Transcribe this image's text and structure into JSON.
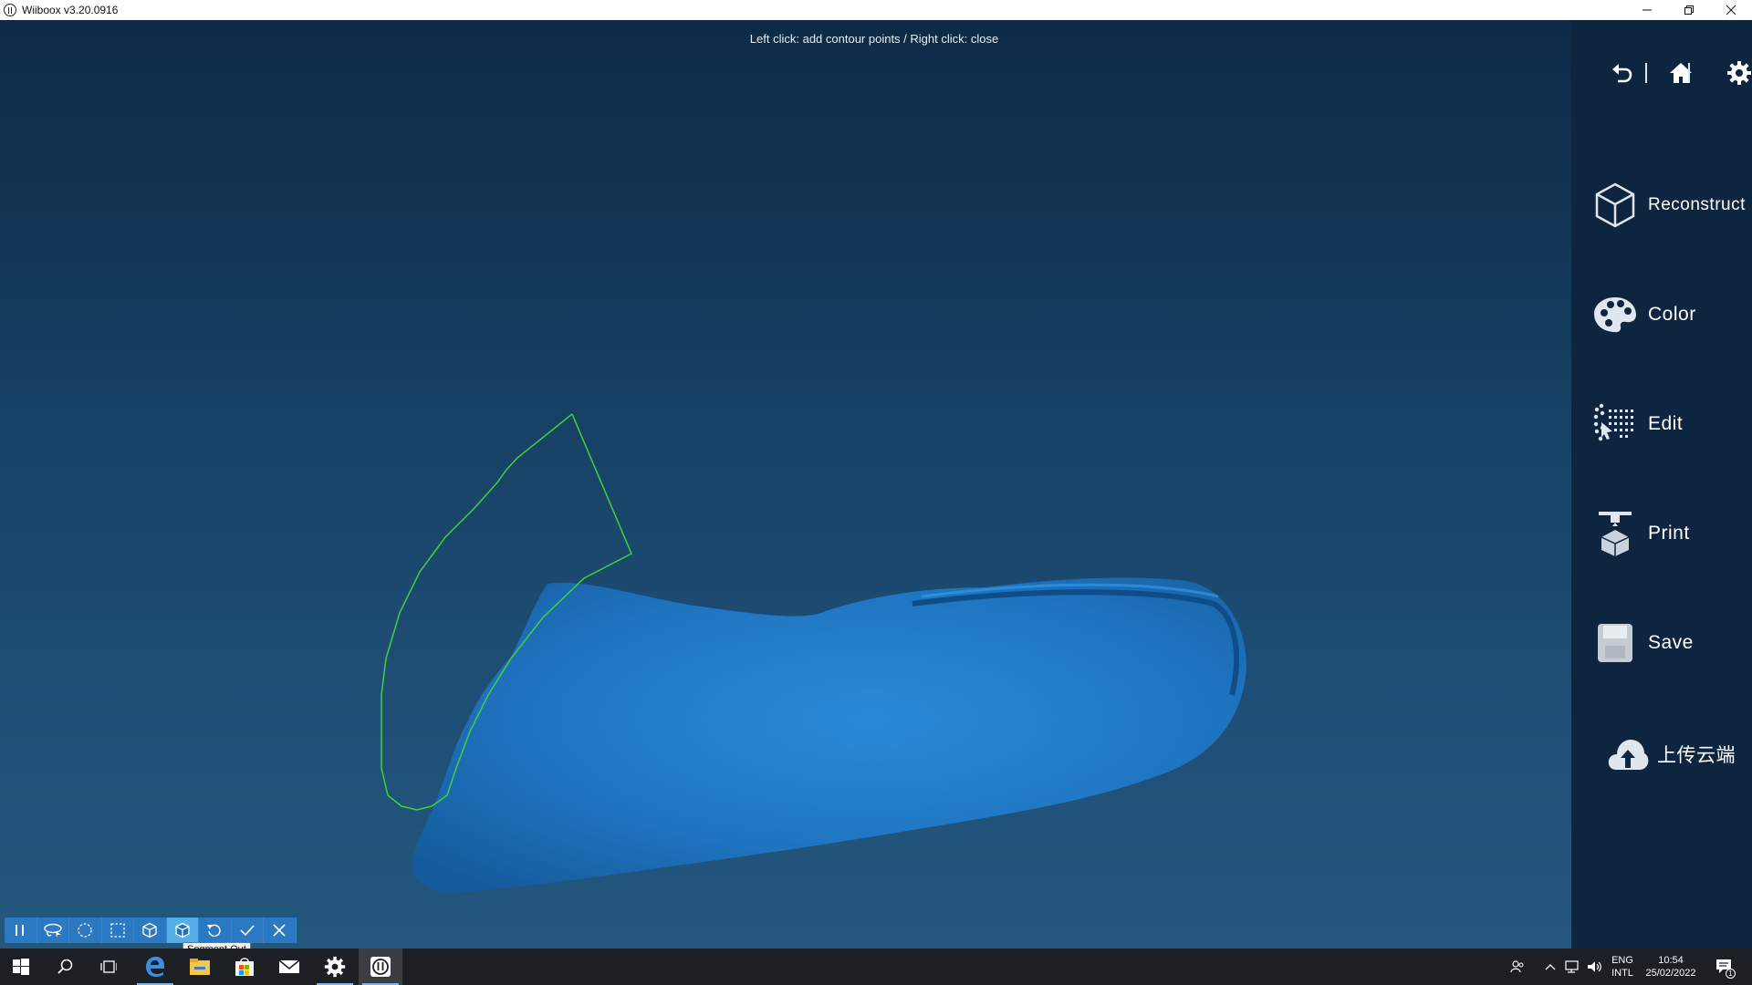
{
  "window": {
    "title": "Wiiboox v3.20.0916",
    "controls": [
      "minimize-icon",
      "restore-icon",
      "close-icon"
    ]
  },
  "viewport": {
    "hint": "Left click: add contour points / Right click: close",
    "model_color": "#1f74c0",
    "contour_color": "#3fd23a",
    "background_top": "#0d2a46",
    "background_bottom": "#24577e"
  },
  "side_panel": {
    "top_icons": [
      "undo-icon",
      "home-icon",
      "settings-icon"
    ],
    "items": [
      {
        "label": "Reconstruct",
        "icon": "cube-icon"
      },
      {
        "label": "Color",
        "icon": "palette-icon"
      },
      {
        "label": "Edit",
        "icon": "edit-points-icon"
      },
      {
        "label": "Print",
        "icon": "printer-icon"
      },
      {
        "label": "Save",
        "icon": "save-icon"
      },
      {
        "label": "上传云端",
        "icon": "cloud-upload-icon"
      }
    ]
  },
  "toolbar": {
    "buttons": [
      "pause-icon",
      "lasso-icon",
      "circle-select-icon",
      "rect-select-icon",
      "segment-in-icon",
      "segment-out-icon",
      "reset-icon",
      "confirm-icon",
      "cancel-icon"
    ],
    "active_button": "segment-out-icon",
    "tooltip": "Segment Out"
  },
  "taskbar": {
    "apps": [
      "start-icon",
      "search-icon",
      "task-view-icon",
      "edge-icon",
      "file-explorer-icon",
      "store-icon",
      "mail-icon",
      "settings-gear-icon",
      "wiiboox-icon"
    ],
    "tray": {
      "lang_line1": "ENG",
      "lang_line2": "INTL",
      "time": "10:54",
      "date": "25/02/2022",
      "notifications": "1"
    },
    "accent": "#7fb3e8"
  }
}
